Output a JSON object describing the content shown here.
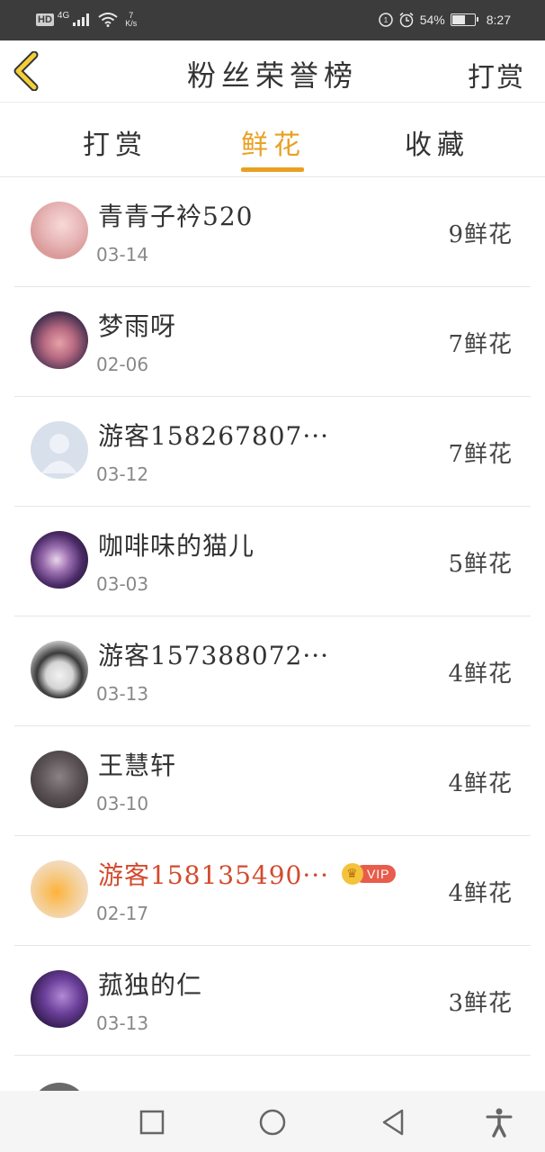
{
  "status_bar": {
    "hd": "HD",
    "network": "4G",
    "speed_value": "7",
    "speed_unit": "K/s",
    "battery": "54%",
    "time": "8:27"
  },
  "header": {
    "title": "粉丝荣誉榜",
    "right_action": "打赏"
  },
  "tabs": [
    {
      "label": "打赏",
      "active": false
    },
    {
      "label": "鲜花",
      "active": true
    },
    {
      "label": "收藏",
      "active": false
    }
  ],
  "fans": [
    {
      "name": "青青子衿520",
      "date": "03-14",
      "count": "9鲜花",
      "vip": false
    },
    {
      "name": "梦雨呀",
      "date": "02-06",
      "count": "7鲜花",
      "vip": false
    },
    {
      "name": "游客158267807···",
      "date": "03-12",
      "count": "7鲜花",
      "vip": false
    },
    {
      "name": "咖啡味的猫儿",
      "date": "03-03",
      "count": "5鲜花",
      "vip": false
    },
    {
      "name": "游客157388072···",
      "date": "03-13",
      "count": "4鲜花",
      "vip": false
    },
    {
      "name": "王慧轩",
      "date": "03-10",
      "count": "4鲜花",
      "vip": false
    },
    {
      "name": "游客158135490···",
      "date": "02-17",
      "count": "4鲜花",
      "vip": true,
      "vip_label": "VIP"
    },
    {
      "name": "菰独的仁",
      "date": "03-13",
      "count": "3鲜花",
      "vip": false
    }
  ],
  "colors": {
    "accent": "#e9a021",
    "vip_name": "#d44a2e",
    "vip_badge": "#e85c4b"
  }
}
